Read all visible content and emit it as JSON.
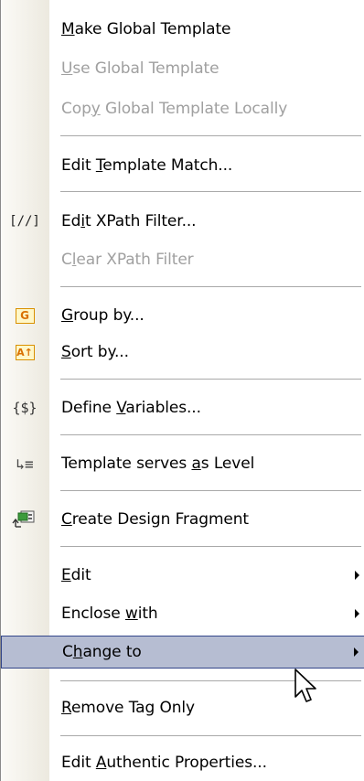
{
  "menu": {
    "items": [
      {
        "id": "make-global-template",
        "pre": "",
        "key": "M",
        "post": "ake Global Template",
        "disabled": false,
        "icon": ""
      },
      {
        "id": "use-global-template",
        "pre": "",
        "key": "U",
        "post": "se Global Template",
        "disabled": true,
        "icon": ""
      },
      {
        "id": "copy-global-template-locally",
        "pre": "Cop",
        "key": "y",
        "post": " Global Template Locally",
        "disabled": true,
        "icon": ""
      },
      {
        "id": "edit-template-match",
        "pre": "Edit ",
        "key": "T",
        "post": "emplate Match...",
        "disabled": false,
        "icon": ""
      },
      {
        "id": "edit-xpath-filter",
        "pre": "Ed",
        "key": "i",
        "post": "t XPath Filter...",
        "disabled": false,
        "icon": "xpath-filter-icon",
        "icon_text": "[//]"
      },
      {
        "id": "clear-xpath-filter",
        "pre": "C",
        "key": "l",
        "post": "ear XPath Filter",
        "disabled": true,
        "icon": ""
      },
      {
        "id": "group-by",
        "pre": "",
        "key": "G",
        "post": "roup by...",
        "disabled": false,
        "icon": "group-icon",
        "icon_text": "G"
      },
      {
        "id": "sort-by",
        "pre": "",
        "key": "S",
        "post": "ort by...",
        "disabled": false,
        "icon": "sort-icon",
        "icon_text": "A↑"
      },
      {
        "id": "define-variables",
        "pre": "Define ",
        "key": "V",
        "post": "ariables...",
        "disabled": false,
        "icon": "variables-icon",
        "icon_text": "{$}"
      },
      {
        "id": "template-serves-as-level",
        "pre": "Template serves ",
        "key": "a",
        "post": "s Level",
        "disabled": false,
        "icon": "level-icon",
        "icon_text": "↳≡"
      },
      {
        "id": "create-design-fragment",
        "pre": "",
        "key": "C",
        "post": "reate Design Fragment",
        "disabled": false,
        "icon": "design-fragment-icon"
      },
      {
        "id": "edit",
        "pre": "",
        "key": "E",
        "post": "dit",
        "disabled": false,
        "icon": "",
        "submenu": true
      },
      {
        "id": "enclose-with",
        "pre": "Enclose ",
        "key": "w",
        "post": "ith",
        "disabled": false,
        "icon": "",
        "submenu": true
      },
      {
        "id": "change-to",
        "pre": "C",
        "key": "h",
        "post": "ange to",
        "disabled": false,
        "icon": "",
        "submenu": true,
        "highlighted": true
      },
      {
        "id": "remove-tag-only",
        "pre": "",
        "key": "R",
        "post": "emove Tag Only",
        "disabled": false,
        "icon": ""
      },
      {
        "id": "edit-authentic-properties",
        "pre": "Edit ",
        "key": "A",
        "post": "uthentic Properties...",
        "disabled": false,
        "icon": ""
      }
    ]
  },
  "colors": {
    "highlight_bg": "#b6bdd2",
    "highlight_border": "#33468a",
    "disabled_text": "#a0a0a0",
    "icon_orange": "#d97000"
  }
}
